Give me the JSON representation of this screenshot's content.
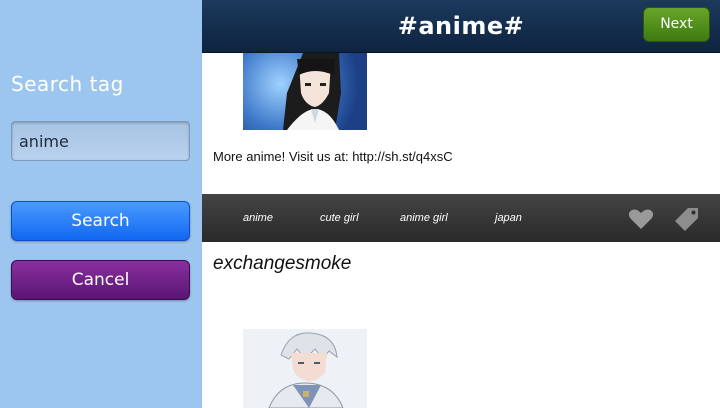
{
  "sidebar": {
    "title": "Search tag",
    "search_value": "anime",
    "search_button": "Search",
    "cancel_button": "Cancel"
  },
  "header": {
    "title": "#anime#",
    "next_button": "Next"
  },
  "posts": [
    {
      "text": "More anime! Visit us at: http://sh.st/q4xsC",
      "tags": [
        "anime",
        "cute girl",
        "anime girl",
        "japan"
      ]
    },
    {
      "username": "exchangesmoke"
    }
  ],
  "icons": [
    "heart-icon",
    "tag-icon"
  ],
  "colors": {
    "sidebar_bg": "#9cc6f0",
    "header_bg": "#0e2440",
    "search_button": "#1167f0",
    "cancel_button": "#5a1573",
    "next_button": "#3d7a10",
    "tagbar_bg": "#2a2a2a"
  }
}
